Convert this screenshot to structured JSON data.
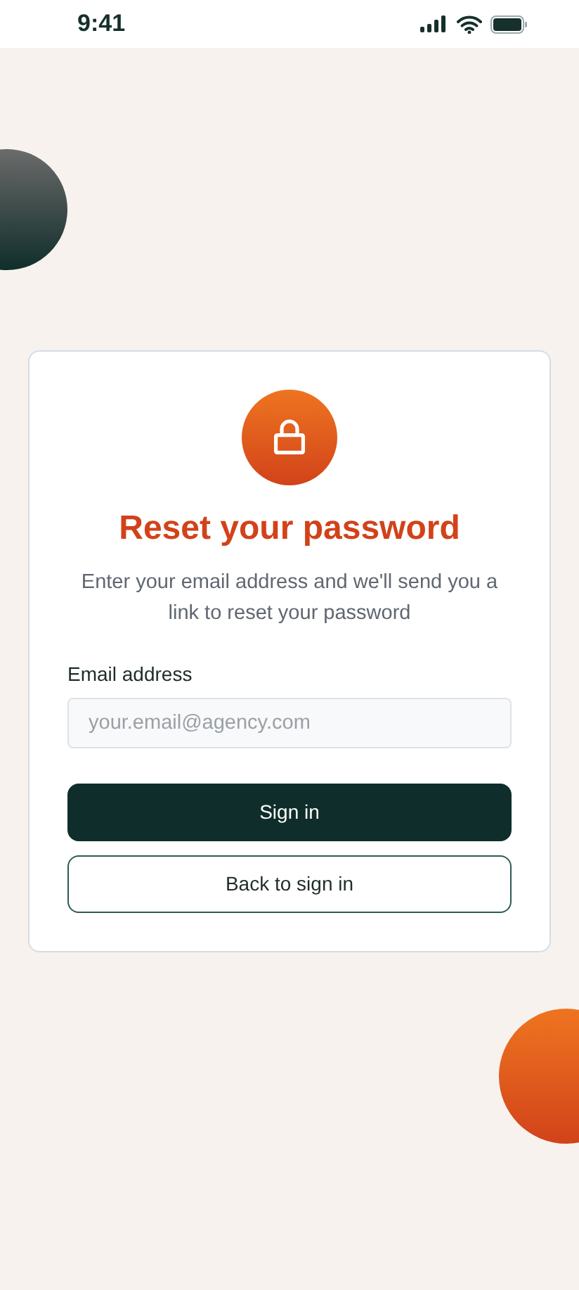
{
  "status_bar": {
    "time": "9:41"
  },
  "card": {
    "title": "Reset your password",
    "description": "Enter your email address and we'll send you a link to reset your password",
    "email_field": {
      "label": "Email address",
      "placeholder": "your.email@agency.com"
    },
    "buttons": [
      {
        "label": "Sign in",
        "kind": "primary"
      },
      {
        "label": "Back to sign in",
        "kind": "secondary"
      }
    ]
  }
}
